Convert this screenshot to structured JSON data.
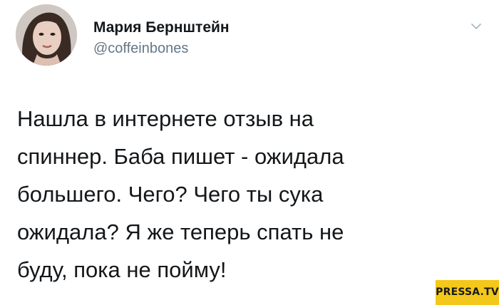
{
  "user": {
    "display_name": "Мария Бернштейн",
    "handle": "@coffeinbones",
    "avatar_icon": "profile-photo"
  },
  "menu": {
    "icon": "chevron-down-icon"
  },
  "tweet": {
    "lines": [
      "Нашла в интернете отзыв на",
      "спиннер. Баба пишет - ожидала",
      "большего. Чего? Чего ты сука",
      "ожидала? Я же теперь спать не",
      "буду, пока не пойму!"
    ]
  },
  "watermark": {
    "text": "PRESSA.TV",
    "color": "#f4c81a"
  },
  "colors": {
    "text": "#14171a",
    "secondary": "#657786"
  }
}
